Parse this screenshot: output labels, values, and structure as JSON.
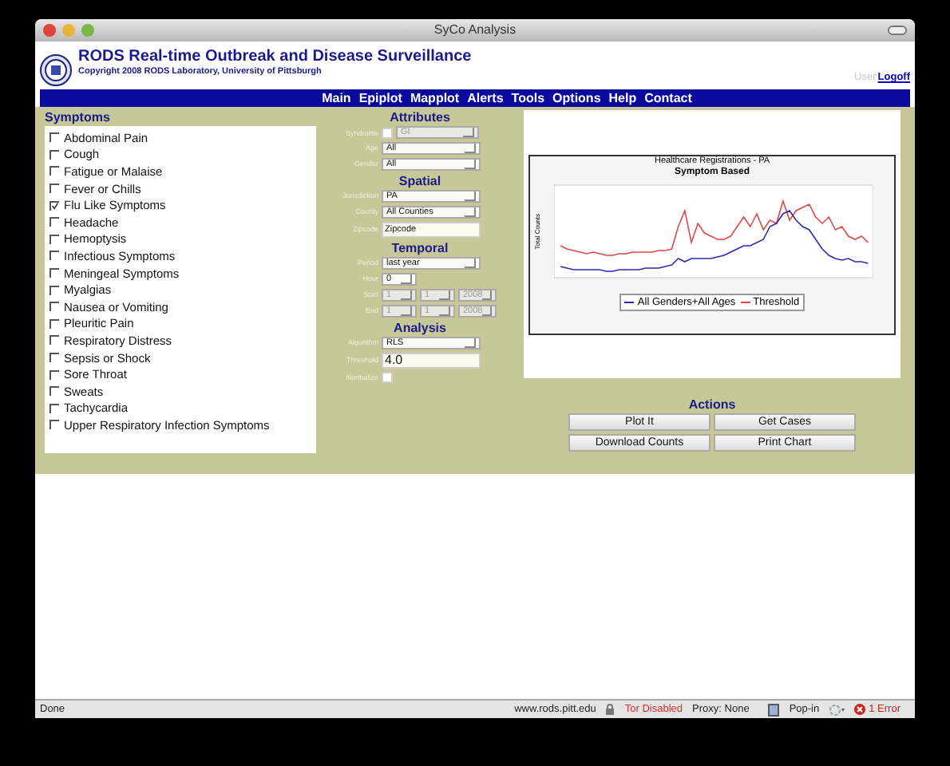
{
  "window": {
    "title": "SyCo Analysis"
  },
  "header": {
    "title": "RODS Real-time Outbreak and Disease Surveillance",
    "copyright": "Copyright 2008 RODS Laboratory, University of Pittsburgh",
    "user": "User",
    "logoff": "Logoff"
  },
  "nav": [
    "Main",
    "Epiplot",
    "Mapplot",
    "Alerts",
    "Tools",
    "Options",
    "Help",
    "Contact"
  ],
  "symptoms": {
    "heading": "Symptoms",
    "items": [
      {
        "label": "Abdominal Pain",
        "checked": false
      },
      {
        "label": "Cough",
        "checked": false
      },
      {
        "label": "Fatigue or Malaise",
        "checked": false
      },
      {
        "label": "Fever or Chills",
        "checked": false
      },
      {
        "label": "Flu Like Symptoms",
        "checked": true
      },
      {
        "label": "Headache",
        "checked": false
      },
      {
        "label": "Hemoptysis",
        "checked": false
      },
      {
        "label": "Infectious Symptoms",
        "checked": false
      },
      {
        "label": "Meningeal Symptoms",
        "checked": false
      },
      {
        "label": "Myalgias",
        "checked": false
      },
      {
        "label": "Nausea or Vomiting",
        "checked": false
      },
      {
        "label": "Pleuritic Pain",
        "checked": false
      },
      {
        "label": "Respiratory Distress",
        "checked": false
      },
      {
        "label": "Sepsis or Shock",
        "checked": false
      },
      {
        "label": "Sore Throat",
        "checked": false
      },
      {
        "label": "Sweats",
        "checked": false
      },
      {
        "label": "Tachycardia",
        "checked": false
      },
      {
        "label": "Upper Respiratory Infection Symptoms",
        "checked": false
      }
    ]
  },
  "form": [
    {
      "heading": "Attributes",
      "rows": [
        {
          "kind": "checkselect",
          "label": "Syndrome",
          "checked": false,
          "value": "GI",
          "disabled": true
        },
        {
          "kind": "select",
          "label": "Age",
          "value": "All",
          "disabled": false
        },
        {
          "kind": "select",
          "label": "Gender",
          "value": "All",
          "disabled": false
        }
      ]
    },
    {
      "heading": "Spatial",
      "rows": [
        {
          "kind": "select",
          "label": "Jurisdiction",
          "value": "PA",
          "disabled": false
        },
        {
          "kind": "select",
          "label": "County",
          "value": "All Counties",
          "disabled": false
        },
        {
          "kind": "text",
          "label": "Zipcode",
          "value": "Zipcode"
        }
      ]
    },
    {
      "heading": "Temporal",
      "rows": [
        {
          "kind": "select",
          "label": "Period",
          "value": "last year",
          "disabled": false
        },
        {
          "kind": "select",
          "label": "Hour",
          "value": "0",
          "disabled": false
        },
        {
          "kind": "date",
          "label": "Start",
          "values": [
            "1",
            "1",
            "2008"
          ],
          "disabled": true
        },
        {
          "kind": "date",
          "label": "End",
          "values": [
            "1",
            "1",
            "2008"
          ],
          "disabled": true
        }
      ]
    },
    {
      "heading": "Analysis",
      "rows": [
        {
          "kind": "select",
          "label": "Algorithm",
          "value": "RLS",
          "disabled": false
        },
        {
          "kind": "text",
          "label": "Threshold",
          "value": "4.0"
        },
        {
          "kind": "checkbox",
          "label": "Normalize",
          "checked": false
        }
      ]
    }
  ],
  "chart": {
    "title": "Healthcare Registrations - PA",
    "subtitle": "Symptom Based",
    "ylabel": "Total Counts",
    "legend": [
      {
        "label": "All Genders+All Ages",
        "color": "#2b2bb0"
      },
      {
        "label": "Threshold",
        "color": "#e04848"
      }
    ]
  },
  "actions": {
    "heading": "Actions",
    "buttons": [
      "Plot It",
      "Get Cases",
      "Download Counts",
      "Print Chart"
    ]
  },
  "status_bar": [
    {
      "kind": "text",
      "label": "Done"
    },
    {
      "kind": "url",
      "label": "www.rods.pitt.edu"
    },
    {
      "kind": "alert",
      "label": "Tor Disabled"
    },
    {
      "kind": "text",
      "label": "Proxy: None"
    },
    {
      "kind": "popin",
      "label": "Pop-in"
    },
    {
      "kind": "error",
      "label": "1 Error"
    }
  ]
}
